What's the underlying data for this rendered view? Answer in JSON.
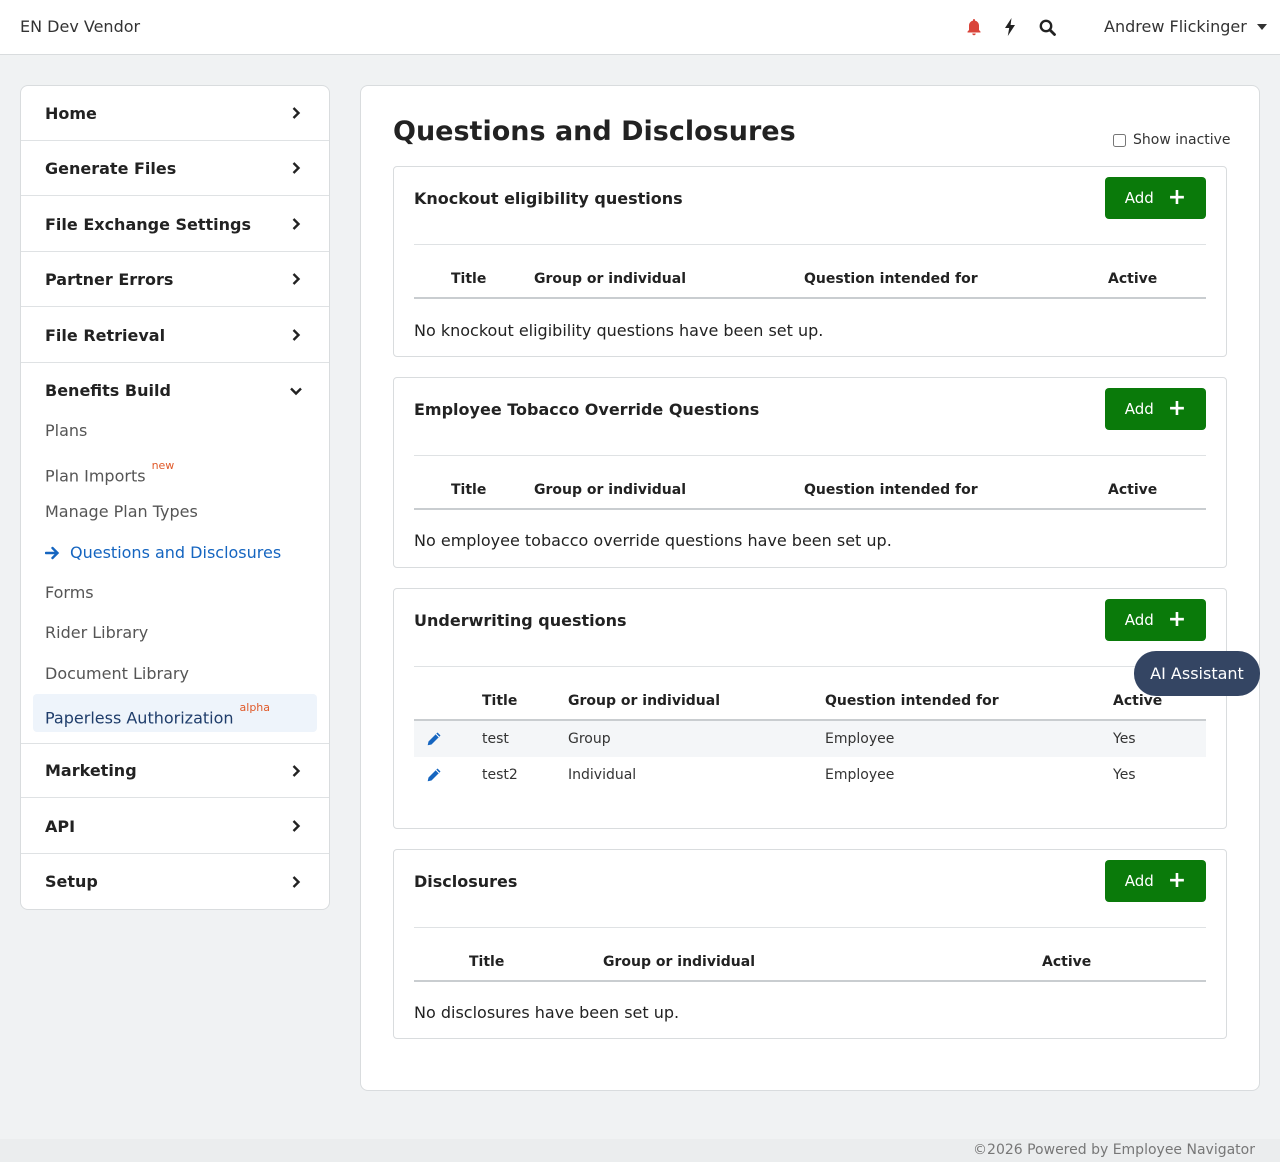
{
  "header": {
    "brand": "EN Dev Vendor",
    "user_name": "Andrew Flickinger",
    "icons": [
      "bell-icon",
      "bolt-icon",
      "search-icon"
    ],
    "bell_color": "#d9443a"
  },
  "sidebar": {
    "items": [
      {
        "label": "Home"
      },
      {
        "label": "Generate Files"
      },
      {
        "label": "File Exchange Settings"
      },
      {
        "label": "Partner Errors"
      },
      {
        "label": "File Retrieval"
      },
      {
        "label": "Benefits Build"
      },
      {
        "label": "Marketing"
      },
      {
        "label": "API"
      },
      {
        "label": "Setup"
      }
    ],
    "sub_items": [
      {
        "label": "Plans"
      },
      {
        "label": "Plan Imports",
        "badge": "new"
      },
      {
        "label": "Manage Plan Types"
      },
      {
        "label": "Questions and Disclosures"
      },
      {
        "label": "Forms"
      },
      {
        "label": "Rider Library"
      },
      {
        "label": "Document Library"
      },
      {
        "label": "Paperless Authorization",
        "badge": "alpha"
      }
    ]
  },
  "main": {
    "title": "Questions and Disclosures",
    "show_inactive_label": "Show inactive",
    "add_label": "Add",
    "sections": [
      {
        "title": "Knockout eligibility questions",
        "headers": [
          "Title",
          "Group or individual",
          "Question intended for",
          "Active"
        ],
        "empty": "No knockout eligibility questions have been set up."
      },
      {
        "title": "Employee Tobacco Override Questions",
        "headers": [
          "Title",
          "Group or individual",
          "Question intended for",
          "Active"
        ],
        "empty": "No employee tobacco override questions have been set up."
      },
      {
        "title": "Underwriting questions",
        "headers": [
          "Title",
          "Group or individual",
          "Question intended for",
          "Active"
        ],
        "rows": [
          [
            "test",
            "Group",
            "Employee",
            "Yes"
          ],
          [
            "test2",
            "Individual",
            "Employee",
            "Yes"
          ]
        ]
      },
      {
        "title": "Disclosures",
        "headers": [
          "Title",
          "Group or individual",
          "Active"
        ],
        "empty": "No disclosures have been set up."
      }
    ]
  },
  "ai_assistant_label": "AI Assistant",
  "footer": "©2026 Powered by Employee Navigator",
  "colors": {
    "accent": "#1565c0",
    "add_button": "#0a7a0a",
    "badge": "#e05a2a",
    "ai_button": "#344563"
  }
}
